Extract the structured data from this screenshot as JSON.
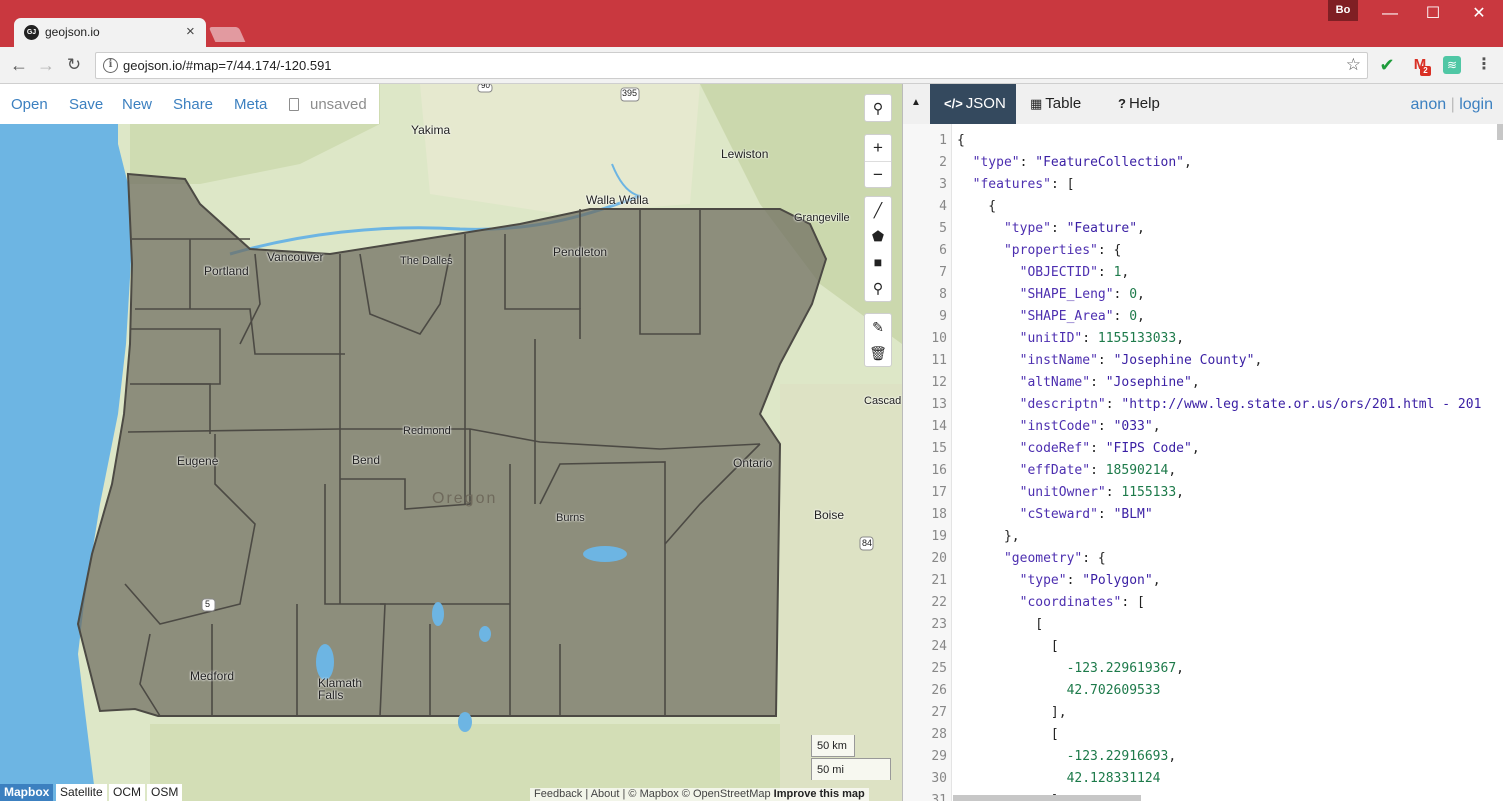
{
  "browser": {
    "tab_title": "geojson.io",
    "tab_favicon": "GJ",
    "tab_close": "×",
    "profile": "Bo",
    "url": "geojson.io/#map=7/44.174/-120.591",
    "icons": {
      "back": "arrow-left-icon",
      "forward": "arrow-right-icon",
      "reload": "reload-icon",
      "star": "star-icon",
      "menu": "more-vert-icon"
    },
    "ext_mail_badge": "2",
    "colors": {
      "frame": "#c9383f",
      "toolbar": "#f2f2f2"
    }
  },
  "map": {
    "file_menu": {
      "open": "Open",
      "save": "Save",
      "new": "New",
      "share": "Share",
      "meta": "Meta",
      "unsaved": "unsaved"
    },
    "labels": {
      "yakima": "Yakima",
      "lewiston": "Lewiston",
      "walla_walla": "Walla Walla",
      "grangeville": "Grangeville",
      "vancouver": "Vancouver",
      "portland": "Portland",
      "the_dalles": "The Dalles",
      "pendleton": "Pendleton",
      "redmond": "Redmond",
      "bend": "Bend",
      "eugene": "Eugene",
      "ontario": "Ontario",
      "burns": "Burns",
      "boise": "Boise",
      "cascade": "Cascad",
      "medford": "Medford",
      "klamath_falls_1": "Klamath",
      "klamath_falls_2": "Falls",
      "state": "Oregon",
      "shield_90": "90",
      "shield_395": "395",
      "shield_5": "5",
      "shield_84": "84"
    },
    "scale_km": "50 km",
    "scale_mi": "50 mi",
    "layers": {
      "mapbox": "Mapbox",
      "satellite": "Satellite",
      "ocm": "OCM",
      "osm": "OSM"
    },
    "attribution": {
      "feedback": "Feedback",
      "about": "About",
      "mapbox": "© Mapbox",
      "osm": "© OpenStreetMap",
      "improve": "Improve this map"
    },
    "colors": {
      "land": "#dde7c7",
      "water": "#6db5e3",
      "polygon_fill": "#6d6c60",
      "polygon_stroke": "#4c4a44"
    }
  },
  "panel": {
    "tabs": {
      "json": "JSON",
      "table": "Table",
      "help": "Help"
    },
    "tab_icons": {
      "json": "code-icon",
      "table": "table-icon",
      "help": "question-icon"
    },
    "auth": {
      "anon": "anon",
      "sep": "|",
      "login": "login"
    },
    "accent": "#34495e",
    "json_lines": [
      [
        [
          "p",
          "{"
        ]
      ],
      [
        [
          "p",
          "  "
        ],
        [
          "k",
          "\"type\""
        ],
        [
          "p",
          ": "
        ],
        [
          "s",
          "\"FeatureCollection\""
        ],
        [
          "p",
          ","
        ]
      ],
      [
        [
          "p",
          "  "
        ],
        [
          "k",
          "\"features\""
        ],
        [
          "p",
          ": ["
        ]
      ],
      [
        [
          "p",
          "    {"
        ]
      ],
      [
        [
          "p",
          "      "
        ],
        [
          "k",
          "\"type\""
        ],
        [
          "p",
          ": "
        ],
        [
          "s",
          "\"Feature\""
        ],
        [
          "p",
          ","
        ]
      ],
      [
        [
          "p",
          "      "
        ],
        [
          "k",
          "\"properties\""
        ],
        [
          "p",
          ": {"
        ]
      ],
      [
        [
          "p",
          "        "
        ],
        [
          "k",
          "\"OBJECTID\""
        ],
        [
          "p",
          ": "
        ],
        [
          "n",
          "1"
        ],
        [
          "p",
          ","
        ]
      ],
      [
        [
          "p",
          "        "
        ],
        [
          "k",
          "\"SHAPE_Leng\""
        ],
        [
          "p",
          ": "
        ],
        [
          "n",
          "0"
        ],
        [
          "p",
          ","
        ]
      ],
      [
        [
          "p",
          "        "
        ],
        [
          "k",
          "\"SHAPE_Area\""
        ],
        [
          "p",
          ": "
        ],
        [
          "n",
          "0"
        ],
        [
          "p",
          ","
        ]
      ],
      [
        [
          "p",
          "        "
        ],
        [
          "k",
          "\"unitID\""
        ],
        [
          "p",
          ": "
        ],
        [
          "n",
          "1155133033"
        ],
        [
          "p",
          ","
        ]
      ],
      [
        [
          "p",
          "        "
        ],
        [
          "k",
          "\"instName\""
        ],
        [
          "p",
          ": "
        ],
        [
          "s",
          "\"Josephine County\""
        ],
        [
          "p",
          ","
        ]
      ],
      [
        [
          "p",
          "        "
        ],
        [
          "k",
          "\"altName\""
        ],
        [
          "p",
          ": "
        ],
        [
          "s",
          "\"Josephine\""
        ],
        [
          "p",
          ","
        ]
      ],
      [
        [
          "p",
          "        "
        ],
        [
          "k",
          "\"descriptn\""
        ],
        [
          "p",
          ": "
        ],
        [
          "s",
          "\"http://www.leg.state.or.us/ors/201.html - 201"
        ]
      ],
      [
        [
          "p",
          "        "
        ],
        [
          "k",
          "\"instCode\""
        ],
        [
          "p",
          ": "
        ],
        [
          "s",
          "\"033\""
        ],
        [
          "p",
          ","
        ]
      ],
      [
        [
          "p",
          "        "
        ],
        [
          "k",
          "\"codeRef\""
        ],
        [
          "p",
          ": "
        ],
        [
          "s",
          "\"FIPS Code\""
        ],
        [
          "p",
          ","
        ]
      ],
      [
        [
          "p",
          "        "
        ],
        [
          "k",
          "\"effDate\""
        ],
        [
          "p",
          ": "
        ],
        [
          "n",
          "18590214"
        ],
        [
          "p",
          ","
        ]
      ],
      [
        [
          "p",
          "        "
        ],
        [
          "k",
          "\"unitOwner\""
        ],
        [
          "p",
          ": "
        ],
        [
          "n",
          "1155133"
        ],
        [
          "p",
          ","
        ]
      ],
      [
        [
          "p",
          "        "
        ],
        [
          "k",
          "\"cSteward\""
        ],
        [
          "p",
          ": "
        ],
        [
          "s",
          "\"BLM\""
        ]
      ],
      [
        [
          "p",
          "      },"
        ]
      ],
      [
        [
          "p",
          "      "
        ],
        [
          "k",
          "\"geometry\""
        ],
        [
          "p",
          ": {"
        ]
      ],
      [
        [
          "p",
          "        "
        ],
        [
          "k",
          "\"type\""
        ],
        [
          "p",
          ": "
        ],
        [
          "s",
          "\"Polygon\""
        ],
        [
          "p",
          ","
        ]
      ],
      [
        [
          "p",
          "        "
        ],
        [
          "k",
          "\"coordinates\""
        ],
        [
          "p",
          ": ["
        ]
      ],
      [
        [
          "p",
          "          ["
        ]
      ],
      [
        [
          "p",
          "            ["
        ]
      ],
      [
        [
          "p",
          "              "
        ],
        [
          "n",
          "-123.229619367"
        ],
        [
          "p",
          ","
        ]
      ],
      [
        [
          "p",
          "              "
        ],
        [
          "n",
          "42.702609533"
        ]
      ],
      [
        [
          "p",
          "            ],"
        ]
      ],
      [
        [
          "p",
          "            ["
        ]
      ],
      [
        [
          "p",
          "              "
        ],
        [
          "n",
          "-123.22916693"
        ],
        [
          "p",
          ","
        ]
      ],
      [
        [
          "p",
          "              "
        ],
        [
          "n",
          "42.128331124"
        ]
      ],
      [
        [
          "p",
          "            ]"
        ]
      ]
    ]
  }
}
